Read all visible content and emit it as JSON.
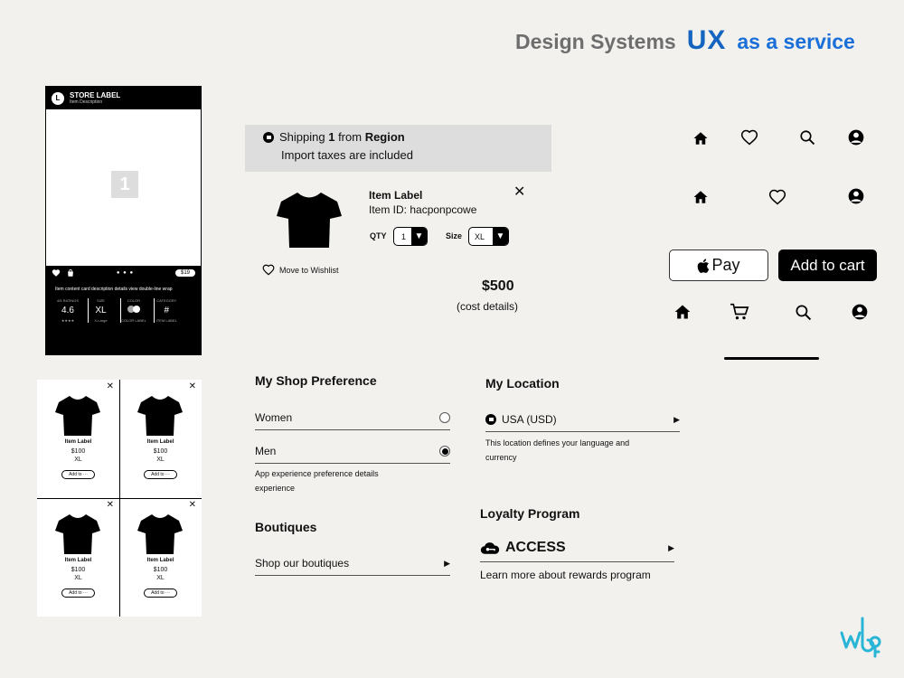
{
  "header": {
    "brand_left": "Design Systems",
    "brand_mid": "UX",
    "brand_right": "as a service"
  },
  "store_card": {
    "logo_letter": "L",
    "label": "STORE LABEL",
    "description": "Item Description",
    "slide_number": "1",
    "price": "$19",
    "details": "Item content card description details view double-line wrap",
    "stats": [
      {
        "title": "4/5 RATINGS",
        "value": "4.6",
        "sub": "★★★★"
      },
      {
        "title": "SIZE",
        "value": "XL",
        "sub": "X-Large"
      },
      {
        "title": "COLOR",
        "value": "",
        "sub": "COLOR LABEL"
      },
      {
        "title": "CATEGORY",
        "value": "#",
        "sub": "ITEM LABEL"
      }
    ]
  },
  "product_grid": {
    "items": [
      {
        "label": "Item Label",
        "price": "$100",
        "size": "XL",
        "button": "Add to ···"
      },
      {
        "label": "Item Label",
        "price": "$100",
        "size": "XL",
        "button": "Add to ···"
      },
      {
        "label": "Item Label",
        "price": "$100",
        "size": "XL",
        "button": "Add to ···"
      },
      {
        "label": "Item Label",
        "price": "$100",
        "size": "XL",
        "button": "Add to ···"
      }
    ],
    "close_glyph": "✕"
  },
  "shipping": {
    "prefix": "Shipping ",
    "count": "1",
    "middle": " from ",
    "region": "Region",
    "taxes": "Import taxes are included"
  },
  "cart_item": {
    "label": "Item Label",
    "item_id": "Item ID: hacponpcowe",
    "qty_label": "QTY",
    "qty_value": "1",
    "size_label": "Size",
    "size_value": "XL",
    "wishlist": "Move to Wishlist",
    "total": "$500",
    "cost_details": "(cost details)",
    "close_glyph": "✕"
  },
  "buttons": {
    "pay_label": "Pay",
    "add_to_cart": "Add to cart"
  },
  "shop_preference": {
    "title": "My Shop Preference",
    "options": [
      {
        "label": "Women",
        "selected": false
      },
      {
        "label": "Men",
        "selected": true
      }
    ],
    "note": "App experience preference details experience"
  },
  "boutiques": {
    "title": "Boutiques",
    "link": "Shop our boutiques"
  },
  "location": {
    "title": "My Location",
    "value": "USA (USD)",
    "note": "This location defines your language and currency"
  },
  "loyalty": {
    "title": "Loyalty Program",
    "program": "ACCESS",
    "link": "Learn more about rewards program"
  },
  "colors": {
    "brand_blue": "#1565c0",
    "background": "#f2f1ee",
    "black": "#000000"
  }
}
